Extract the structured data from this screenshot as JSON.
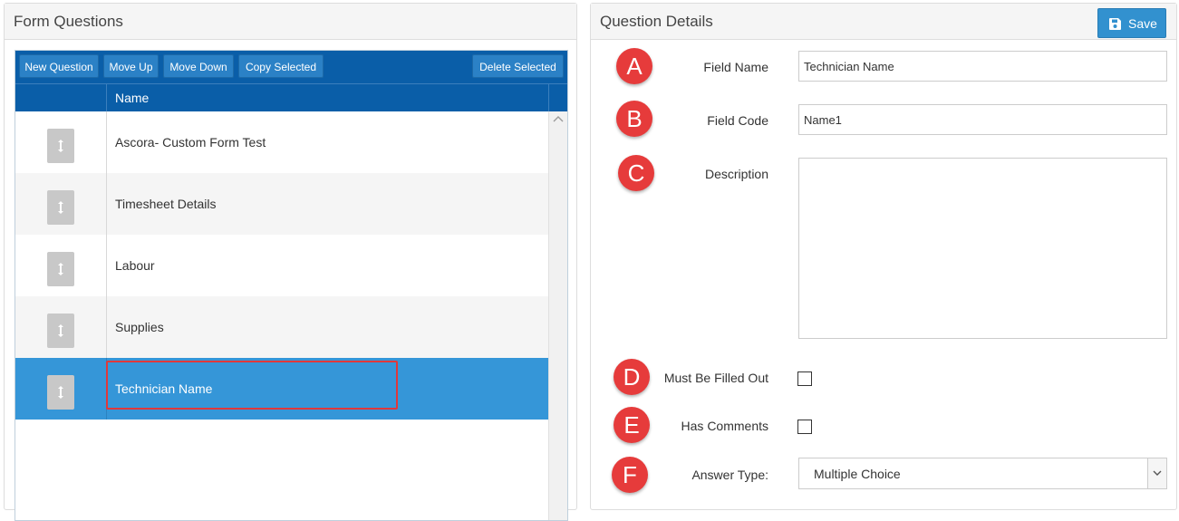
{
  "left_panel": {
    "title": "Form Questions",
    "toolbar": {
      "new_question": "New Question",
      "move_up": "Move Up",
      "move_down": "Move Down",
      "copy_selected": "Copy Selected",
      "delete_selected": "Delete Selected"
    },
    "grid": {
      "column_header": "Name",
      "rows": [
        {
          "label": "Ascora- Custom Form Test"
        },
        {
          "label": "Timesheet Details"
        },
        {
          "label": "Labour"
        },
        {
          "label": "Supplies"
        },
        {
          "label": "Technician Name",
          "selected": true
        }
      ]
    }
  },
  "right_panel": {
    "title": "Question Details",
    "save_label": "Save",
    "fields": {
      "field_name": {
        "badge": "A",
        "label": "Field Name",
        "value": "Technician Name"
      },
      "field_code": {
        "badge": "B",
        "label": "Field Code",
        "value": "Name1"
      },
      "description": {
        "badge": "C",
        "label": "Description",
        "value": ""
      },
      "must_be_filled_out": {
        "badge": "D",
        "label": "Must Be Filled Out",
        "checked": false
      },
      "has_comments": {
        "badge": "E",
        "label": "Has Comments",
        "checked": false
      },
      "answer_type": {
        "badge": "F",
        "label": "Answer Type:",
        "value": "Multiple Choice"
      }
    }
  },
  "colors": {
    "toolbar_bg": "#0a5ea8",
    "button_bg": "#2b81c6",
    "selected_row": "#3596d8",
    "badge": "#e63b3b",
    "highlight_border": "#e0383b"
  }
}
